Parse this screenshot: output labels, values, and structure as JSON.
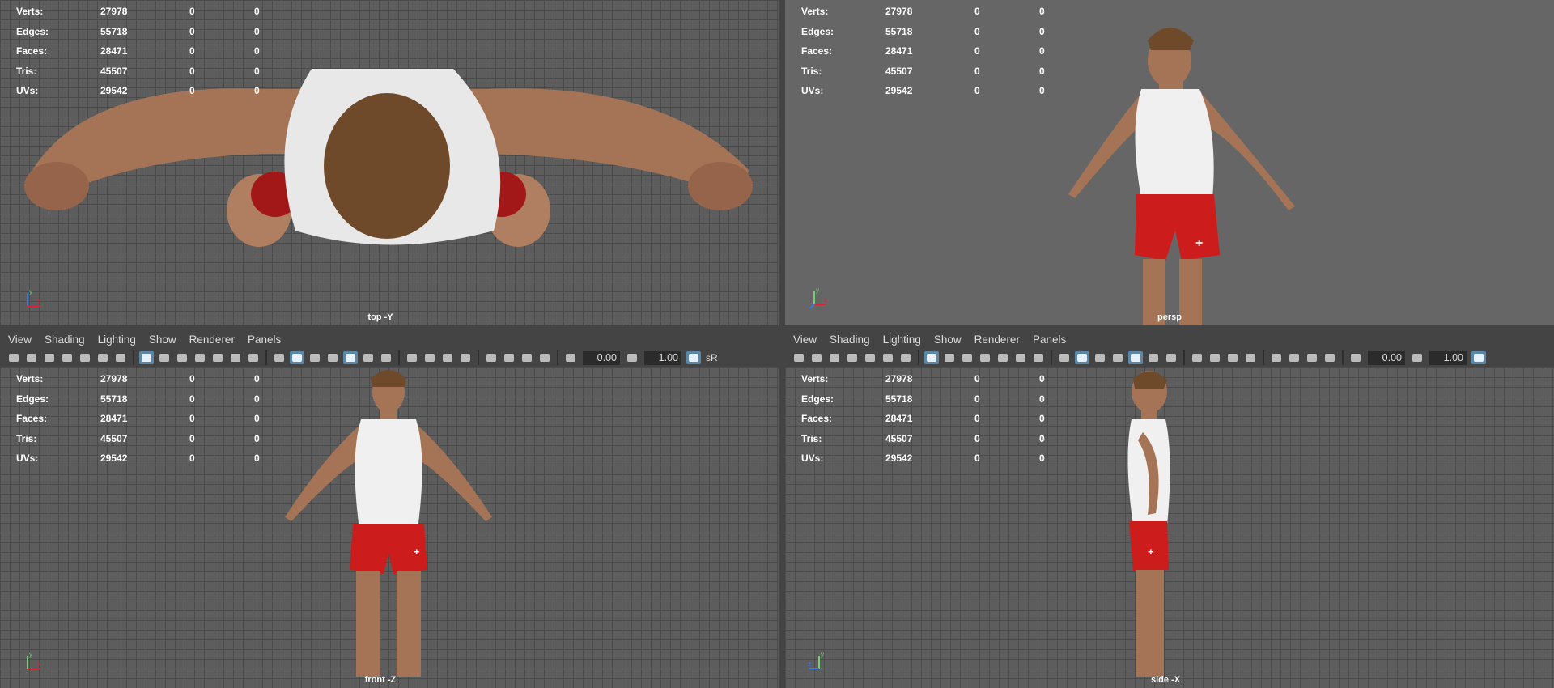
{
  "menus": [
    "View",
    "Shading",
    "Lighting",
    "Show",
    "Renderer",
    "Panels"
  ],
  "toolbar": {
    "field_a": "0.00",
    "field_b": "1.00",
    "extra_label": "sR"
  },
  "hud": {
    "rows": [
      {
        "label": "Verts:",
        "value": "27978",
        "z1": "0",
        "z2": "0"
      },
      {
        "label": "Edges:",
        "value": "55718",
        "z1": "0",
        "z2": "0"
      },
      {
        "label": "Faces:",
        "value": "28471",
        "z1": "0",
        "z2": "0"
      },
      {
        "label": "Tris:",
        "value": "45507",
        "z1": "0",
        "z2": "0"
      },
      {
        "label": "UVs:",
        "value": "29542",
        "z1": "0",
        "z2": "0"
      }
    ]
  },
  "viewports": {
    "top": {
      "camera": "top -Y"
    },
    "persp": {
      "camera": "persp"
    },
    "front": {
      "camera": "front -Z"
    },
    "side": {
      "camera": "side -X"
    }
  },
  "colors": {
    "panel_bg": "#444444",
    "grid_bg": "#5d5d5d",
    "persp_bg": "#666666",
    "accent": "#5b87a8",
    "shorts": "#cc1c1c",
    "skin": "#a57456"
  },
  "icons": [
    "camera-icon",
    "bookmark-icon",
    "grid-icon",
    "wireframe-icon",
    "smooth-shade-icon",
    "light-icon",
    "exposure-icon",
    "gamma-icon"
  ]
}
